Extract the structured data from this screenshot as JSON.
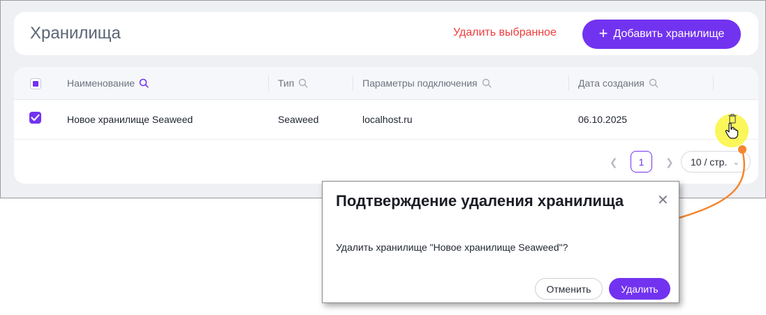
{
  "header": {
    "title": "Хранилища",
    "delete_selected_label": "Удалить выбранное",
    "add_button_label": "Добавить хранилище",
    "add_button_icon": "plus-icon"
  },
  "table": {
    "columns": [
      {
        "label": "Наименование",
        "icon": "search-icon",
        "active": true
      },
      {
        "label": "Тип",
        "icon": "search-icon",
        "active": false
      },
      {
        "label": "Параметры подключения",
        "icon": "search-icon",
        "active": false
      },
      {
        "label": "Дата создания",
        "icon": "search-icon",
        "active": false
      }
    ],
    "rows": [
      {
        "name": "Новое хранилище Seaweed",
        "type": "Seaweed",
        "connection": "localhost.ru",
        "created": "06.10.2025",
        "checked": true,
        "action_icon": "trash-icon"
      }
    ]
  },
  "pagination": {
    "prev_icon": "chevron-left-icon",
    "current_page": "1",
    "next_icon": "chevron-right-icon",
    "page_size": "10 / стр."
  },
  "modal": {
    "title": "Подтверждение удаления хранилища",
    "close_icon": "close-icon",
    "message": "Удалить хранилище \"Новое хранилище Seaweed\"?",
    "cancel_label": "Отменить",
    "confirm_label": "Удалить"
  },
  "colors": {
    "accent": "#7233f0",
    "danger": "#ee3b3b",
    "annotation": "#f5862e",
    "highlight": "#faf53c"
  }
}
